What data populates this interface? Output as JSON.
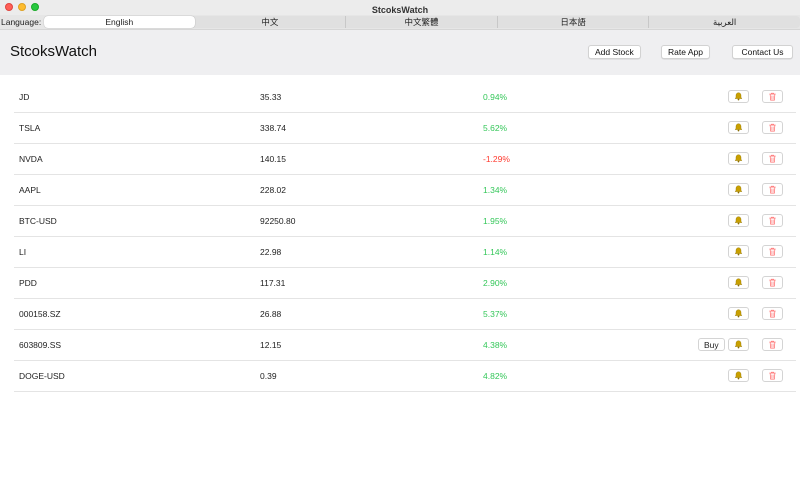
{
  "window": {
    "title": "StcoksWatch"
  },
  "language": {
    "label": "Language:",
    "options": [
      "English",
      "中文",
      "中文繁體",
      "日本語",
      "العربية"
    ],
    "selected": "English"
  },
  "header": {
    "title": "StcoksWatch",
    "add_stock": "Add Stock",
    "rate_app": "Rate App",
    "contact_us": "Contact Us"
  },
  "colors": {
    "positive": "#34c759",
    "negative": "#ff3b30",
    "bell": "#c9a000",
    "trash": "#ff6b6b"
  },
  "icons": {
    "alert": "bell-icon",
    "delete": "trash-icon"
  },
  "stocks": [
    {
      "symbol": "JD",
      "price": "35.33",
      "change": "0.94%",
      "trend": "pos",
      "buy": ""
    },
    {
      "symbol": "TSLA",
      "price": "338.74",
      "change": "5.62%",
      "trend": "pos",
      "buy": ""
    },
    {
      "symbol": "NVDA",
      "price": "140.15",
      "change": "-1.29%",
      "trend": "neg",
      "buy": ""
    },
    {
      "symbol": "AAPL",
      "price": "228.02",
      "change": "1.34%",
      "trend": "pos",
      "buy": ""
    },
    {
      "symbol": "BTC-USD",
      "price": "92250.80",
      "change": "1.95%",
      "trend": "pos",
      "buy": ""
    },
    {
      "symbol": "LI",
      "price": "22.98",
      "change": "1.14%",
      "trend": "pos",
      "buy": ""
    },
    {
      "symbol": "PDD",
      "price": "117.31",
      "change": "2.90%",
      "trend": "pos",
      "buy": ""
    },
    {
      "symbol": "000158.SZ",
      "price": "26.88",
      "change": "5.37%",
      "trend": "pos",
      "buy": ""
    },
    {
      "symbol": "603809.SS",
      "price": "12.15",
      "change": "4.38%",
      "trend": "pos",
      "buy": "Buy"
    },
    {
      "symbol": "DOGE-USD",
      "price": "0.39",
      "change": "4.82%",
      "trend": "pos",
      "buy": ""
    }
  ]
}
